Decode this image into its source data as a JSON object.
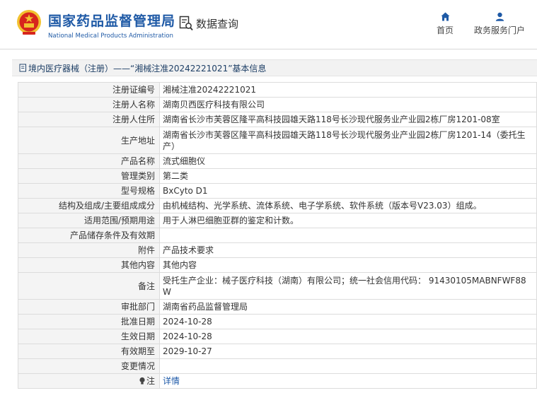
{
  "site": {
    "name_cn": "国家药品监督管理局",
    "name_en": "National Medical Products Administration",
    "query_label": "数据查询"
  },
  "nav": {
    "home": "首页",
    "gov_portal": "政务服务门户"
  },
  "breadcrumb": {
    "text": "境内医疗器械（注册）——“湘械注准20242221021”基本信息"
  },
  "record": {
    "rows": [
      {
        "label": "注册证编号",
        "value": "湘械注准20242221021"
      },
      {
        "label": "注册人名称",
        "value": "湖南贝西医疗科技有限公司"
      },
      {
        "label": "注册人住所",
        "value": "湖南省长沙市芙蓉区隆平高科技园雄天路118号长沙现代服务业产业园2栋厂房1201-08室"
      },
      {
        "label": "生产地址",
        "value": "湖南省长沙市芙蓉区隆平高科技园雄天路118号长沙现代服务业产业园2栋厂房1201-14（委托生产）"
      },
      {
        "label": "产品名称",
        "value": "流式细胞仪"
      },
      {
        "label": "管理类别",
        "value": "第二类"
      },
      {
        "label": "型号规格",
        "value": "BxCyto D1"
      },
      {
        "label": "结构及组成/主要组成成分",
        "value": "由机械结构、光学系统、流体系统、电子学系统、软件系统（版本号V23.03）组成。"
      },
      {
        "label": "适用范围/预期用途",
        "value": "用于人淋巴细胞亚群的鉴定和计数。"
      },
      {
        "label": "产品储存条件及有效期",
        "value": ""
      },
      {
        "label": "附件",
        "value": "产品技术要求"
      },
      {
        "label": "其他内容",
        "value": "其他内容"
      },
      {
        "label": "备注",
        "value": "受托生产企业：械子医疗科技（湖南）有限公司；统一社会信用代码： 91430105MABNFWF88W"
      },
      {
        "label": "审批部门",
        "value": "湖南省药品监督管理局"
      },
      {
        "label": "批准日期",
        "value": "2024-10-28"
      },
      {
        "label": "生效日期",
        "value": "2024-10-28"
      },
      {
        "label": "有效期至",
        "value": "2029-10-27"
      },
      {
        "label": "变更情况",
        "value": ""
      },
      {
        "label": "注",
        "value": "详情"
      }
    ]
  },
  "colors": {
    "brand_blue": "#1f5aa6",
    "link_blue": "#1e5aa8",
    "label_bg": "#f4f4f4",
    "emblem_red": "#d7261d",
    "emblem_gold": "#f2c230"
  },
  "icons": {
    "logo": "national-emblem-icon",
    "query": "data-search-icon",
    "home": "home-icon",
    "gov": "user-icon",
    "breadcrumb": "document-icon",
    "note": "lightbulb-icon"
  }
}
